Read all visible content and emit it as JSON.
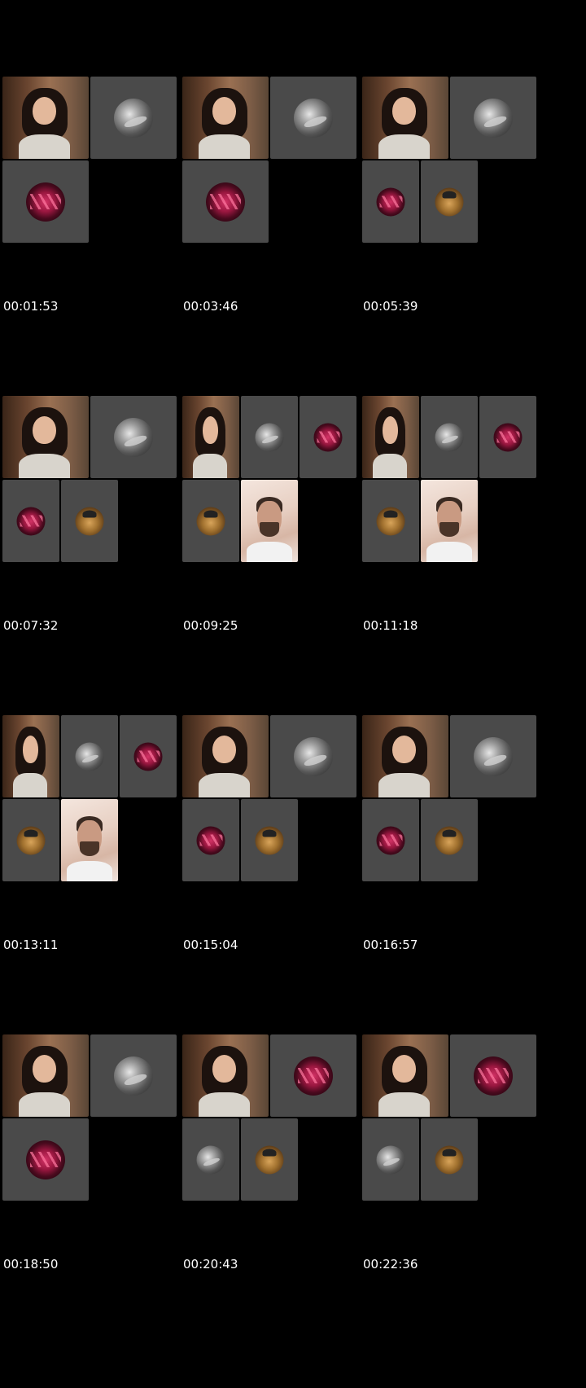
{
  "grid": {
    "columns": 3,
    "rows": 4
  },
  "frames": [
    {
      "timestamp": "00:01:53",
      "layout": "A",
      "tiles": [
        "girl-video",
        "moon-avatar",
        "stage-avatar"
      ]
    },
    {
      "timestamp": "00:03:46",
      "layout": "A",
      "tiles": [
        "girl-video",
        "moon-avatar",
        "stage-avatar"
      ]
    },
    {
      "timestamp": "00:05:39",
      "layout": "B",
      "tiles": [
        "girl-video",
        "moon-avatar",
        "stage-avatar",
        "selfie-avatar"
      ]
    },
    {
      "timestamp": "00:07:32",
      "layout": "B",
      "tiles": [
        "girl-video",
        "moon-avatar",
        "stage-avatar",
        "selfie-avatar"
      ]
    },
    {
      "timestamp": "00:09:25",
      "layout": "C",
      "tiles": [
        "girl-video",
        "moon-avatar",
        "stage-avatar",
        "selfie-avatar",
        "man-video"
      ]
    },
    {
      "timestamp": "00:11:18",
      "layout": "C",
      "tiles": [
        "girl-video",
        "moon-avatar",
        "stage-avatar",
        "selfie-avatar",
        "man-video"
      ]
    },
    {
      "timestamp": "00:13:11",
      "layout": "C",
      "tiles": [
        "girl-video",
        "moon-avatar",
        "stage-avatar",
        "selfie-avatar",
        "man-video"
      ]
    },
    {
      "timestamp": "00:15:04",
      "layout": "B",
      "tiles": [
        "girl-video",
        "moon-avatar",
        "stage-avatar",
        "selfie-avatar"
      ]
    },
    {
      "timestamp": "00:16:57",
      "layout": "B",
      "tiles": [
        "girl-video",
        "moon-avatar",
        "stage-avatar",
        "selfie-avatar"
      ]
    },
    {
      "timestamp": "00:18:50",
      "layout": "A",
      "tiles": [
        "girl-video",
        "moon-avatar",
        "stage-avatar"
      ]
    },
    {
      "timestamp": "00:20:43",
      "layout": "B",
      "tiles": [
        "girl-video",
        "stage-avatar",
        "moon-avatar",
        "selfie-avatar"
      ]
    },
    {
      "timestamp": "00:22:36",
      "layout": "B",
      "tiles": [
        "girl-video",
        "stage-avatar",
        "moon-avatar",
        "selfie-avatar"
      ]
    }
  ],
  "colors": {
    "background": "#000000",
    "tile_background": "#4a4a4a",
    "timestamp_text": "#ffffff"
  },
  "icons": {
    "moon-avatar": "moon-avatar-icon",
    "stage-avatar": "stage-lights-avatar-icon",
    "selfie-avatar": "selfie-avatar-icon"
  }
}
